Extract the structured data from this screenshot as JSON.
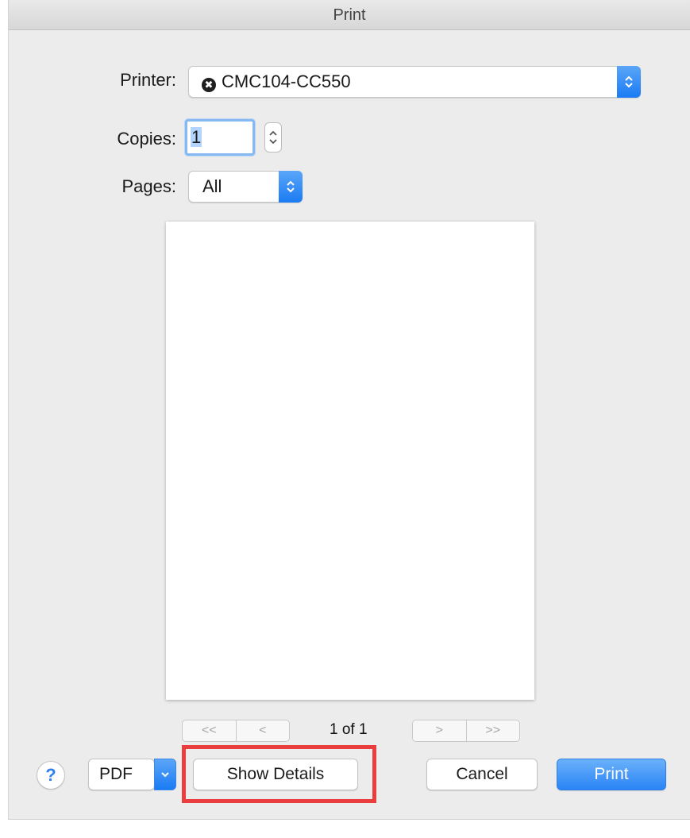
{
  "window": {
    "title": "Print"
  },
  "printer": {
    "label": "Printer:",
    "value": "CMC104-CC550",
    "status": "✖"
  },
  "copies": {
    "label": "Copies:",
    "value": "1"
  },
  "pages": {
    "label": "Pages:",
    "value": "All"
  },
  "pagination": {
    "first": "<<",
    "prev": "<",
    "counter": "1 of 1",
    "next": ">",
    "last": ">>"
  },
  "footer": {
    "help": "?",
    "pdf": "PDF",
    "show_details": "Show Details",
    "cancel": "Cancel",
    "print": "Print"
  },
  "colors": {
    "accent": "#1a7bf3",
    "highlight": "#ea3d3d"
  }
}
